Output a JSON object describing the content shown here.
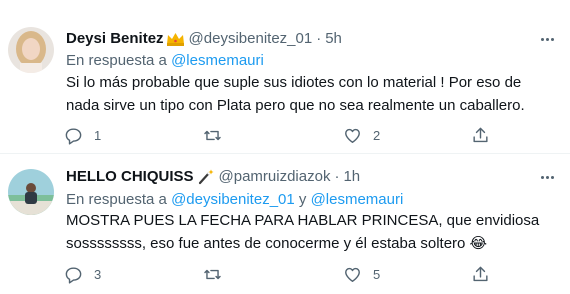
{
  "tweets": [
    {
      "name": "Deysi Benitez",
      "badge_icon": "crown-emoji",
      "handle": "@deysibenitez_01",
      "dot": "·",
      "time": "5h",
      "reply_prefix": "En respuesta a ",
      "mentions": [
        "@lesmemauri"
      ],
      "text": "Si lo más probable que suple sus idiotes con lo material ! Por eso de nada sirve un tipo con Plata pero que no sea realmente un caballero.",
      "replies": "1",
      "retweets": "",
      "likes": "2"
    },
    {
      "name": "HELLO CHIQUISS",
      "badge_icon": "magic-wand-emoji",
      "handle": "@pamruizdiazok",
      "dot": "·",
      "time": "1h",
      "reply_prefix": "En respuesta a ",
      "mentions": [
        "@deysibenitez_01",
        "@lesmemauri"
      ],
      "mention_joiner": " y ",
      "text": "MOSTRA PUES LA FECHA PARA HABLAR PRINCESA, que envidiosa sossssssss, eso fue antes de conocerme y él estaba soltero 😂",
      "replies": "3",
      "retweets": "",
      "likes": "5"
    }
  ],
  "colors": {
    "link": "#1d9bf0",
    "secondary": "#536471",
    "primary": "#0f1419",
    "divider": "#eff3f4"
  }
}
